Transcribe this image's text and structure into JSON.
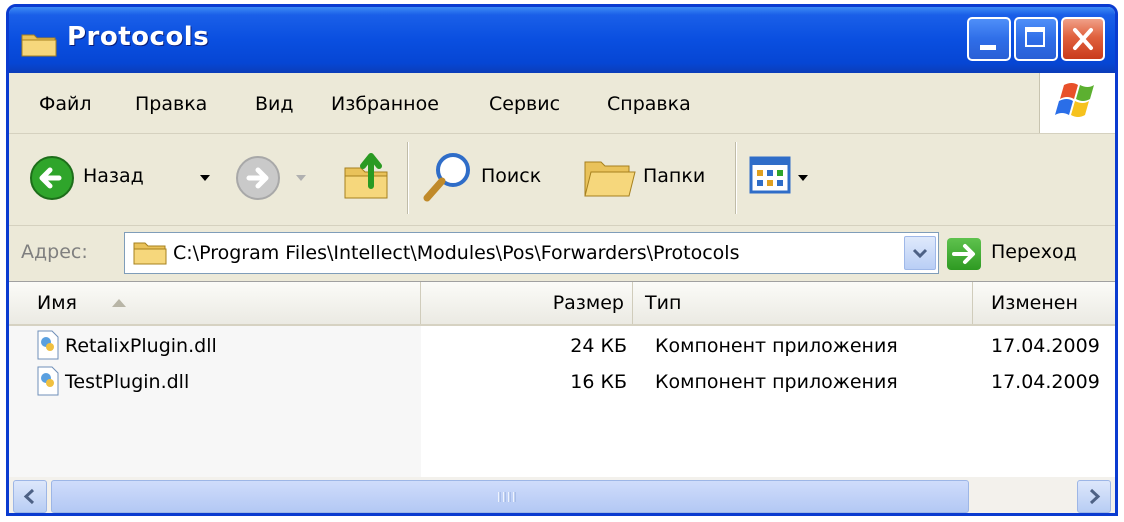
{
  "window": {
    "title": "Protocols",
    "controls": {
      "minimize": "minimize-button",
      "maximize": "maximize-button",
      "close": "close-button"
    }
  },
  "menu": {
    "items": [
      "Файл",
      "Правка",
      "Вид",
      "Избранное",
      "Сервис",
      "Справка"
    ]
  },
  "toolbar": {
    "back_label": "Назад",
    "search_label": "Поиск",
    "folders_label": "Папки"
  },
  "address": {
    "label": "Адрес:",
    "value": "C:\\Program Files\\Intellect\\Modules\\Pos\\Forwarders\\Protocols",
    "go_label": "Переход"
  },
  "list": {
    "columns": [
      "Имя",
      "Размер",
      "Тип",
      "Изменен"
    ],
    "sorted_column": "Имя",
    "rows": [
      {
        "name": "RetalixPlugin.dll",
        "size": "24 КБ",
        "type": "Компонент приложения",
        "modified": "17.04.2009"
      },
      {
        "name": "TestPlugin.dll",
        "size": "16 КБ",
        "type": "Компонент приложения",
        "modified": "17.04.2009"
      }
    ]
  },
  "colors": {
    "titlebar": "#0a4fe0",
    "chrome": "#ece9d8",
    "close_button": "#e0613e"
  },
  "icons": [
    "folder-icon",
    "windows-logo-icon",
    "back-arrow-icon",
    "forward-arrow-icon",
    "up-folder-icon",
    "search-icon",
    "folders-icon",
    "views-icon",
    "go-arrow-icon",
    "dll-file-icon"
  ]
}
